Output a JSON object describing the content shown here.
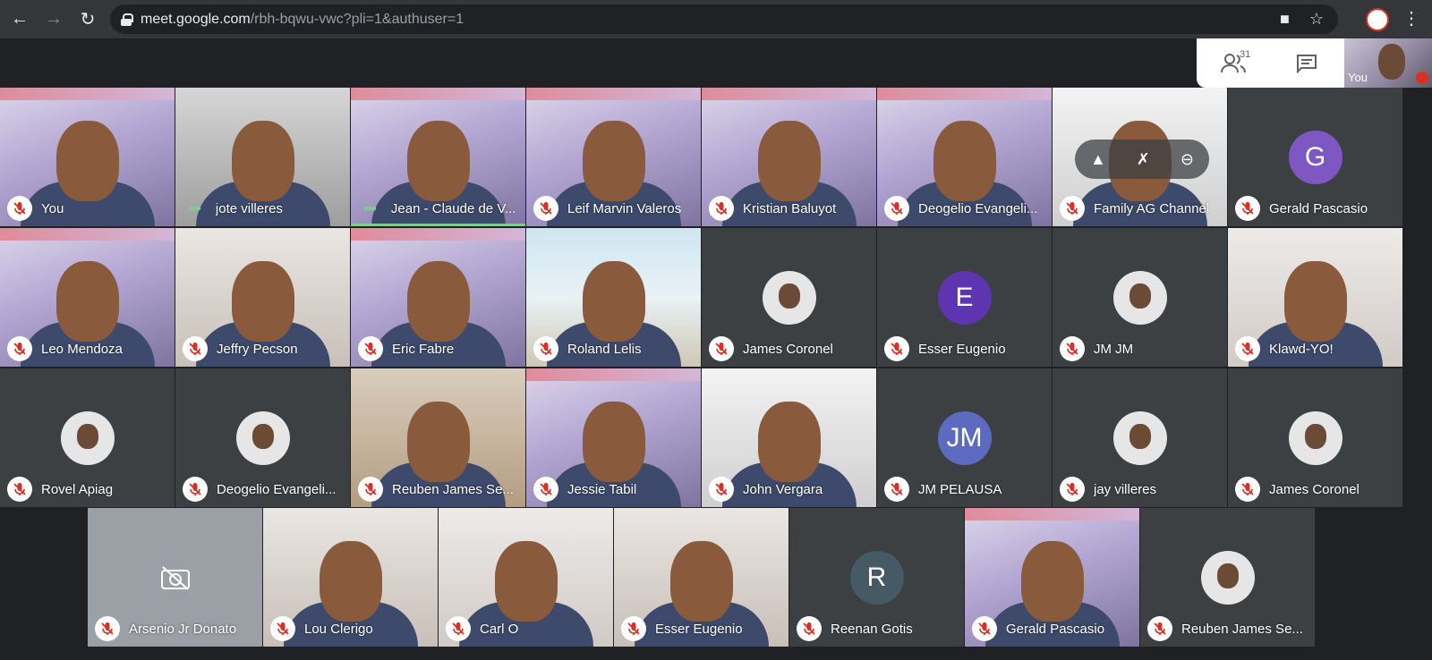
{
  "browser": {
    "url_host": "meet.google.com",
    "url_path": "/rbh-bqwu-vwc?pli=1&authuser=1",
    "back_icon": "arrow-left-icon",
    "forward_icon": "arrow-right-icon",
    "reload_icon": "reload-icon"
  },
  "meet": {
    "participant_count": "31",
    "self_label": "You"
  },
  "colors": {
    "muted": "#d93025",
    "speaking": "#81c995",
    "tile": "#3c4043"
  },
  "tiles": [
    {
      "name": "You",
      "kind": "video-a"
    },
    {
      "name": "jote villeres",
      "kind": "video-d",
      "dots": true
    },
    {
      "name": "Jean - Claude de V...",
      "kind": "video-a",
      "dots": true
    },
    {
      "name": "Leif Marvin Valeros",
      "kind": "video-a"
    },
    {
      "name": "Kristian Baluyot",
      "kind": "video-a"
    },
    {
      "name": "Deogelio Evangeli...",
      "kind": "video-a"
    },
    {
      "name": "Family AG Channel",
      "kind": "video-g"
    },
    {
      "name": "Gerald Pascasio",
      "kind": "avatar",
      "letter": "G",
      "color": "#7e57c2"
    },
    {
      "name": "Leo Mendoza",
      "kind": "video-a"
    },
    {
      "name": "Jeffry Pecson",
      "kind": "video-e"
    },
    {
      "name": "Eric Fabre",
      "kind": "video-a"
    },
    {
      "name": "Roland Lelis",
      "kind": "video-b"
    },
    {
      "name": "James Coronel",
      "kind": "avatar-photo"
    },
    {
      "name": "Esser Eugenio",
      "kind": "avatar",
      "letter": "E",
      "color": "#5e35b1"
    },
    {
      "name": "JM JM",
      "kind": "avatar-photo"
    },
    {
      "name": "Klawd-YO!",
      "kind": "video-f"
    },
    {
      "name": "Rovel Apiag",
      "kind": "avatar-photo"
    },
    {
      "name": "Deogelio Evangeli...",
      "kind": "avatar-photo"
    },
    {
      "name": "Reuben James Se...",
      "kind": "video-c"
    },
    {
      "name": "Jessie Tabil",
      "kind": "video-a"
    },
    {
      "name": "John Vergara",
      "kind": "video-g"
    },
    {
      "name": "JM PELAUSA",
      "kind": "avatar",
      "letter": "JM",
      "color": "#5c6bc0"
    },
    {
      "name": "jay villeres",
      "kind": "avatar-photo"
    },
    {
      "name": "James Coronel",
      "kind": "avatar-photo"
    },
    {
      "name": "Arsenio Jr Donato",
      "kind": "camoff"
    },
    {
      "name": "Lou Clerigo",
      "kind": "video-e"
    },
    {
      "name": "Carl O",
      "kind": "video-f"
    },
    {
      "name": "Esser Eugenio",
      "kind": "video-e"
    },
    {
      "name": "Reenan Gotis",
      "kind": "avatar",
      "letter": "R",
      "color": "#455a64"
    },
    {
      "name": "Gerald Pascasio",
      "kind": "video-a"
    },
    {
      "name": "Reuben James Se...",
      "kind": "avatar-photo"
    }
  ]
}
